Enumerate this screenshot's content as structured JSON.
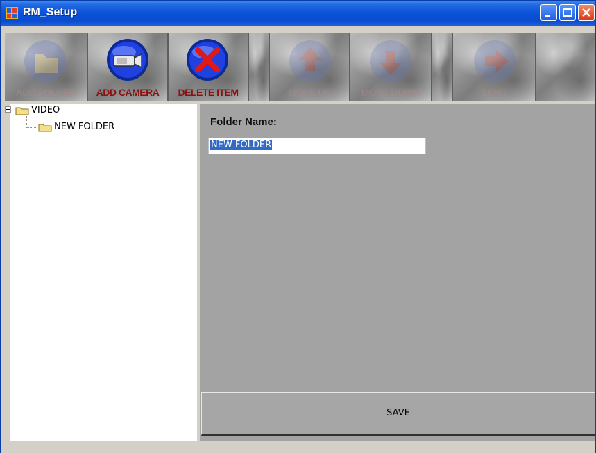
{
  "window": {
    "title": "RM_Setup"
  },
  "toolbar": {
    "buttons": [
      {
        "label": "ADD FOLDER",
        "enabled": false,
        "icon": "folder-icon"
      },
      {
        "label": "ADD CAMERA",
        "enabled": true,
        "icon": "camera-icon"
      },
      {
        "label": "DELETE ITEM",
        "enabled": true,
        "icon": "delete-x-icon"
      },
      {
        "label": "MOVE UP",
        "enabled": false,
        "icon": "arrow-up-icon"
      },
      {
        "label": "MOVE DOWN",
        "enabled": false,
        "icon": "arrow-down-icon"
      },
      {
        "label": "SEND",
        "enabled": false,
        "icon": "arrow-right-icon"
      }
    ]
  },
  "tree": {
    "root": {
      "label": "VIDEO",
      "expanded": true
    },
    "child": {
      "label": "NEW FOLDER"
    }
  },
  "form": {
    "folder_name_label": "Folder Name:",
    "folder_name_value": "NEW FOLDER",
    "save_label": "SAVE"
  },
  "colors": {
    "titlebar": "#0a52d8",
    "label_enabled": "#8b1010",
    "selection": "#316ac5",
    "panel_bg": "#a3a3a3"
  }
}
